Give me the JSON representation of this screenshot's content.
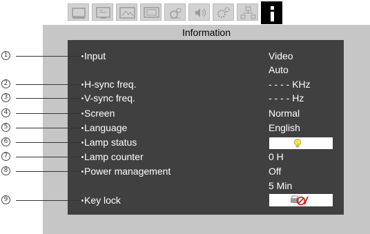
{
  "tabs": [
    {
      "icon": "display-icon",
      "active": false
    },
    {
      "icon": "pc-adjust-icon",
      "active": false
    },
    {
      "icon": "image-icon",
      "active": false
    },
    {
      "icon": "screen-icon",
      "active": false
    },
    {
      "icon": "setting-icon",
      "active": false
    },
    {
      "icon": "sound-icon",
      "active": false
    },
    {
      "icon": "expand-icon",
      "active": false
    },
    {
      "icon": "network-icon",
      "active": false
    },
    {
      "icon": "information-icon",
      "active": true,
      "label": "i"
    }
  ],
  "panel": {
    "title": "Information"
  },
  "rows": [
    {
      "callout": "1",
      "label": "Input",
      "value": "Video",
      "value2": "Auto"
    },
    {
      "callout": "2",
      "label": "H-sync freq.",
      "value": "- - - - KHz"
    },
    {
      "callout": "3",
      "label": "V-sync freq.",
      "value": "- - - - Hz"
    },
    {
      "callout": "4",
      "label": "Screen",
      "value": "Normal"
    },
    {
      "callout": "5",
      "label": "Language",
      "value": "English"
    },
    {
      "callout": "6",
      "label": "Lamp status",
      "value_icon": "lamp-icon"
    },
    {
      "callout": "7",
      "label": "Lamp counter",
      "value": "0 H"
    },
    {
      "callout": "8",
      "label": "Power management",
      "value": "Off",
      "value2": "5 Min"
    },
    {
      "callout": "9",
      "label": "Key lock",
      "value_icon": "key-lock-off-icon"
    }
  ],
  "colors": {
    "background": "#ffffff",
    "tab": "#d2d2d2",
    "tab_active": "#000000",
    "panel": "#c6c6c6",
    "info_box": "#404040",
    "text_light": "#ffffff",
    "lamp": "#f2e14a",
    "lock_mark": "#cc2222"
  }
}
